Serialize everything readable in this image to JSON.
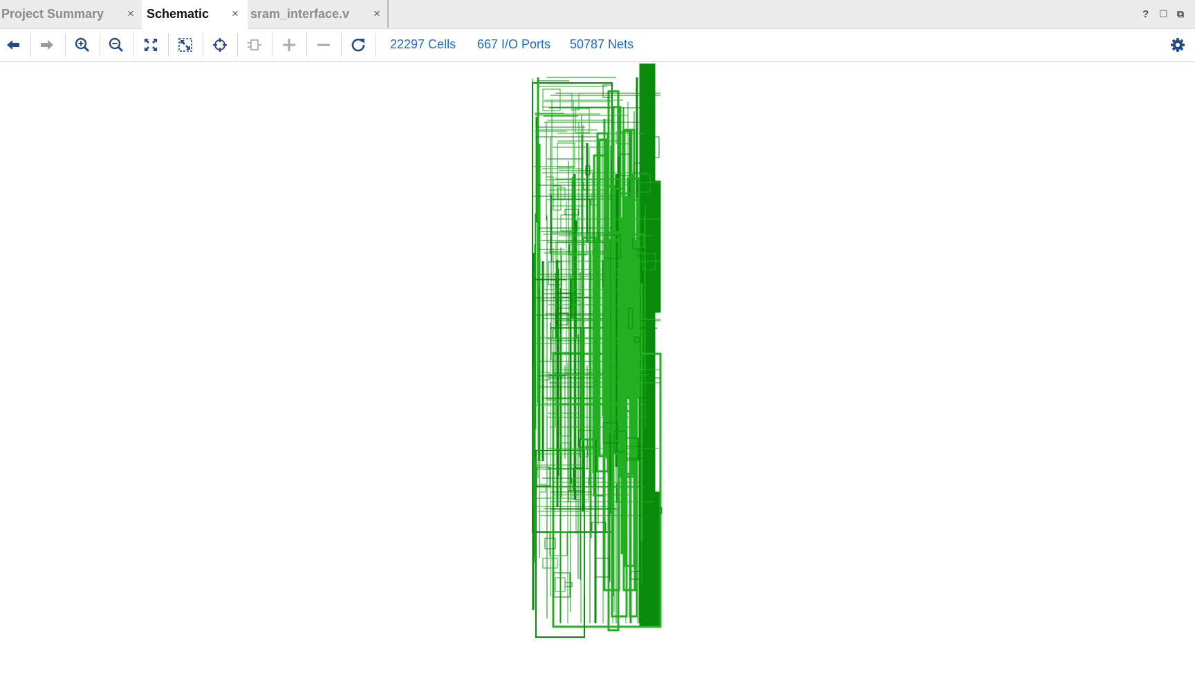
{
  "tabs": [
    {
      "label": "Project Summary",
      "close": "×",
      "active": false
    },
    {
      "label": "Schematic",
      "close": "×",
      "active": true
    },
    {
      "label": "sram_interface.v",
      "close": "×",
      "active": false
    }
  ],
  "window_controls": {
    "help": "?",
    "maximize": "☐",
    "float": "⧉"
  },
  "toolbar": {
    "buttons": [
      "back-icon",
      "forward-icon",
      "zoom-in-icon",
      "zoom-out-icon",
      "fit-icon",
      "zoom-selection-icon",
      "select-target-icon",
      "cell-icon",
      "expand-plus-icon",
      "collapse-minus-icon",
      "refresh-icon"
    ],
    "settings_icon": "gear-icon"
  },
  "stats": {
    "cells": "22297 Cells",
    "io_ports": "667 I/O Ports",
    "nets": "50787 Nets"
  },
  "colors": {
    "accent": "#1a6ccf",
    "toolbar_icon": "#244a8c",
    "net_dark": "#0a8a0a",
    "net_light": "#22b022"
  }
}
